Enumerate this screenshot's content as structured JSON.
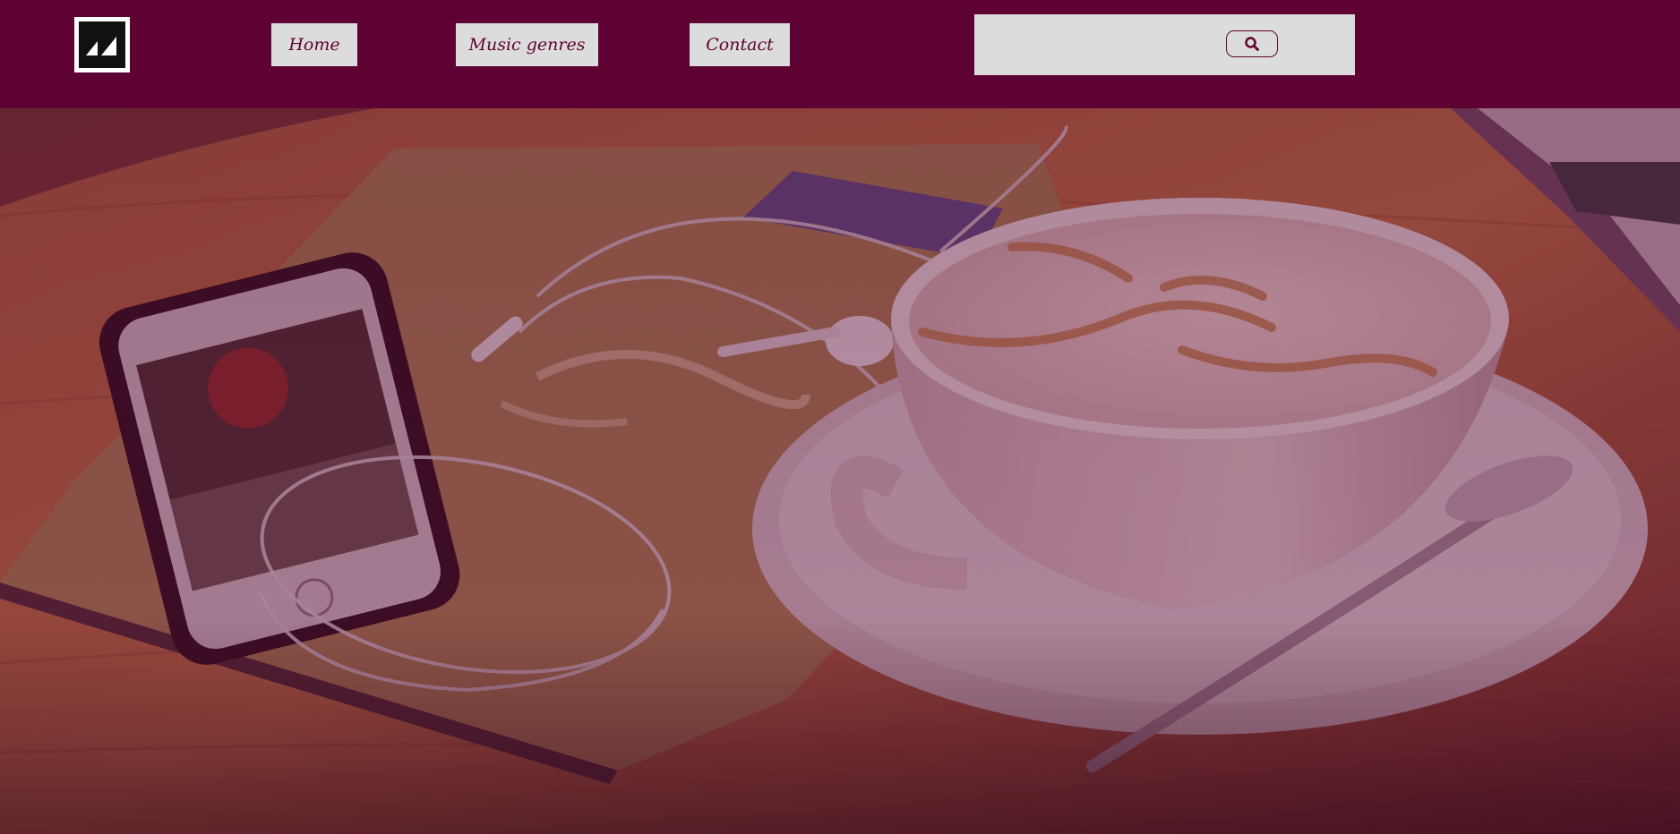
{
  "header": {
    "logo": {
      "icon": "logo-mark-icon"
    },
    "nav": [
      {
        "label": "Home"
      },
      {
        "label": "Music genres"
      },
      {
        "label": "Contact"
      }
    ],
    "search": {
      "value": "",
      "button_icon": "search-icon"
    }
  },
  "hero": {
    "image": "coffee-cup-phone-earphones-photo"
  },
  "colors": {
    "header_bg": "#5e0233",
    "nav_bg": "#dcdcdc",
    "nav_text": "#5e0233",
    "overlay_tint": "#6a0a3a"
  }
}
